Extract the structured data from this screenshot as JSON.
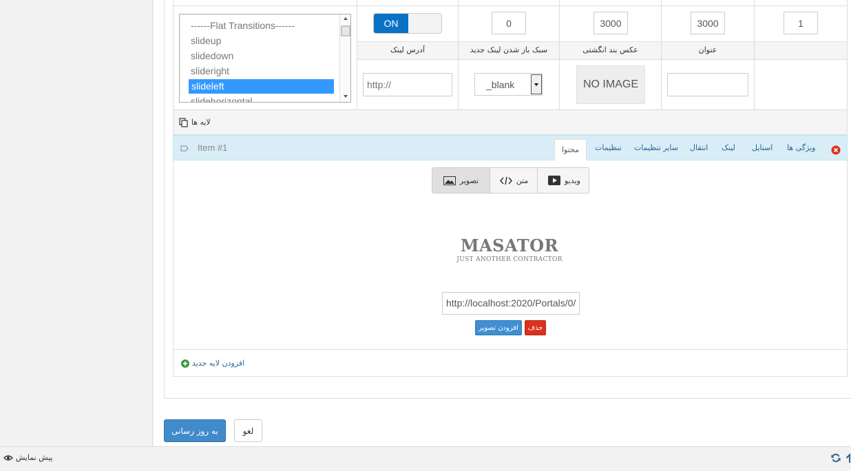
{
  "row1": {
    "transitions": {
      "options": [
        "------Flat Transitions------",
        "slideup",
        "slidedown",
        "slideright",
        "slideleft",
        "slidehorizontal"
      ],
      "selected_index": 4
    },
    "toggle_label": "ON",
    "field_a": "0",
    "field_b": "3000",
    "field_c": "3000",
    "field_d": "1"
  },
  "row2": {
    "headers": {
      "link_address": "آدرس لینک",
      "link_open_style": "سبک باز شدن لینک جدید",
      "indicator_image": "عکس بند انگشتی",
      "title": "عنوان"
    },
    "link_placeholder": "http://",
    "target_value": "_blank",
    "no_image": "NO IMAGE",
    "title_value": ""
  },
  "layers_label": "لایه ها",
  "item": {
    "name": "Item #1",
    "tabs": [
      "ویژگی ها",
      "استایل",
      "لینک",
      "انتقال",
      "سایر تنظیمات",
      "تنظیمات",
      "محتوا"
    ],
    "active_tab": "محتوا"
  },
  "content_types": {
    "video": "ویدیو",
    "text": "متن",
    "image": "تصویر"
  },
  "logo": {
    "title": "MASATOR",
    "subtitle": "JUST ANOTHER CONTRACTOR"
  },
  "image_url": "http://localhost:2020/Portals/0/",
  "buttons": {
    "delete": "حذف",
    "add_image": "افزودن تصویر",
    "add_layer": "افزودن لایه جدید",
    "update": "به روز رسانی",
    "cancel": "لغو"
  },
  "footer": {
    "preview": "پیش نمایش"
  }
}
